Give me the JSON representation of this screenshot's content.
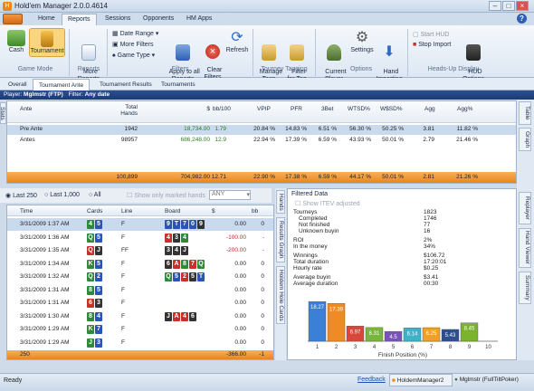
{
  "window": {
    "title": "Hold'em Manager 2.0.0.4614"
  },
  "menu_tabs": [
    "Home",
    "Reports",
    "Sessions",
    "Opponents",
    "HM Apps"
  ],
  "ribbon": {
    "cash": "Cash",
    "tournament": "Tournament",
    "game_mode": "Game Mode",
    "more_reports": "More\nReports",
    "reports": "Reports",
    "date_range": "Date Range",
    "more_filters": "More Filters",
    "game_type": "Game Type",
    "apply_all": "Apply to all\nReports",
    "clear_filters": "Clear\nFilters",
    "refresh": "Refresh",
    "filters": "Filters",
    "manage_tags": "Manage\nTags",
    "filter_for_tag": "Filter\nfor Tag",
    "tourney_tagging": "Tourney Tagging",
    "current_player": "Current\nPlayer",
    "settings": "Settings",
    "hand_importing": "Hand\nImporting",
    "options": "Options",
    "start_hud": "Start HUD",
    "stop_import": "Stop Import",
    "hud_options": "HUD\nOptions",
    "heads_up_display": "Heads-Up Display"
  },
  "sub_tabs": [
    "Overall",
    "Tournament Ante",
    "Tournament Results",
    "Tournaments"
  ],
  "player_bar": {
    "player_label": "Player:",
    "player": "Mglmstr (FTP)",
    "filter_label": "Filter:",
    "filter": "Any date"
  },
  "stats_table": {
    "headers": [
      "Ante",
      "Total\nHands",
      "$",
      "bb/100",
      "VPIP",
      "PFR",
      "3Bet",
      "WTSD%",
      "W$SD%",
      "Agg",
      "Agg%"
    ],
    "rows": [
      [
        "Pre Ante",
        "1942",
        "18,734.00",
        "1.79",
        "20.84 %",
        "14.83 %",
        "6.51 %",
        "56.30 %",
        "50.25 %",
        "3.81",
        "11.82 %"
      ],
      [
        "Antes",
        "98957",
        "686,248.00",
        "12.9",
        "22.94 %",
        "17.39 %",
        "6.59 %",
        "43.93 %",
        "50.01 %",
        "2.79",
        "21.46 %"
      ]
    ],
    "totals": [
      "",
      "100,899",
      "704,982.00",
      "12.71",
      "22.90 %",
      "17.38 %",
      "6.59 %",
      "44.17 %",
      "50.01 %",
      "2.81",
      "21.26 %"
    ],
    "stats_vtab": "Stats"
  },
  "right_vtabs_top": [
    "Table",
    "Graph"
  ],
  "hands_filter": {
    "last250": "Last 250",
    "last1000": "Last 1,000",
    "all": "All",
    "marked": "Show only marked hands",
    "any": "ANY"
  },
  "hands_table": {
    "headers": [
      "Time",
      "Cards",
      "Line",
      "Board",
      "$",
      "bb"
    ],
    "rows": [
      {
        "time": "3/31/2009 1:37 AM",
        "cards": [
          [
            "4",
            "g"
          ],
          [
            "5",
            "b"
          ]
        ],
        "line": "F",
        "board": [
          [
            "9",
            "b"
          ],
          [
            "T",
            "b"
          ],
          [
            "7",
            "b"
          ],
          [
            "0",
            "b"
          ],
          [
            "9",
            "k"
          ]
        ],
        "money": "0.00",
        "bb": "0"
      },
      {
        "time": "3/31/2009 1:36 AM",
        "cards": [
          [
            "Q",
            "g"
          ],
          [
            "5",
            "b"
          ]
        ],
        "line": "F",
        "board": [
          [
            "4",
            "r"
          ],
          [
            "3",
            "k"
          ],
          [
            "4",
            "g"
          ]
        ],
        "money": "-100.00",
        "bb": "-"
      },
      {
        "time": "3/31/2009 1:35 AM",
        "cards": [
          [
            "Q",
            "r"
          ],
          [
            "J",
            "k"
          ]
        ],
        "line": "FF",
        "board": [
          [
            "3",
            "k"
          ],
          [
            "4",
            "k"
          ],
          [
            "J",
            "k"
          ]
        ],
        "money": "-200.00",
        "bb": "-"
      },
      {
        "time": "3/31/2009 1:34 AM",
        "cards": [
          [
            "K",
            "g"
          ],
          [
            "5",
            "b"
          ]
        ],
        "line": "F",
        "board": [
          [
            "6",
            "k"
          ],
          [
            "A",
            "r"
          ],
          [
            "8",
            "g"
          ],
          [
            "7",
            "r"
          ],
          [
            "Q",
            "g"
          ]
        ],
        "money": "0.00",
        "bb": "0"
      },
      {
        "time": "3/31/2009 1:32 AM",
        "cards": [
          [
            "Q",
            "g"
          ],
          [
            "2",
            "b"
          ]
        ],
        "line": "F",
        "board": [
          [
            "Q",
            "g"
          ],
          [
            "5",
            "b"
          ],
          [
            "2",
            "r"
          ],
          [
            "5",
            "k"
          ],
          [
            "T",
            "b"
          ]
        ],
        "money": "0.00",
        "bb": "0"
      },
      {
        "time": "3/31/2009 1:31 AM",
        "cards": [
          [
            "8",
            "g"
          ],
          [
            "5",
            "b"
          ]
        ],
        "line": "F",
        "board": [],
        "money": "0.00",
        "bb": "0"
      },
      {
        "time": "3/31/2009 1:31 AM",
        "cards": [
          [
            "6",
            "r"
          ],
          [
            "3",
            "k"
          ]
        ],
        "line": "F",
        "board": [],
        "money": "0.00",
        "bb": "0"
      },
      {
        "time": "3/31/2009 1:30 AM",
        "cards": [
          [
            "8",
            "g"
          ],
          [
            "4",
            "b"
          ]
        ],
        "line": "F",
        "board": [
          [
            "J",
            "k"
          ],
          [
            "A",
            "r"
          ],
          [
            "4",
            "r"
          ],
          [
            "6",
            "k"
          ]
        ],
        "money": "0.00",
        "bb": "0"
      },
      {
        "time": "3/31/2009 1:29 AM",
        "cards": [
          [
            "K",
            "g"
          ],
          [
            "7",
            "b"
          ]
        ],
        "line": "F",
        "board": [],
        "money": "0.00",
        "bb": "0"
      },
      {
        "time": "3/31/2009 1:29 AM",
        "cards": [
          [
            "J",
            "g"
          ],
          [
            "3",
            "b"
          ]
        ],
        "line": "F",
        "board": [],
        "money": "0.00",
        "bb": "0"
      }
    ],
    "total_count": "250",
    "total_money": "-366.00",
    "total_bb": "-1"
  },
  "mid_vtabs": [
    "Hands",
    "Results Graph",
    "Holdem Hole Cards"
  ],
  "filtered": {
    "title": "Filtered Data",
    "show_itev": "Show ITEV adjusted",
    "rows": [
      [
        "Tourneys",
        "1823"
      ],
      [
        "Completed",
        "1746"
      ],
      [
        "Not finished",
        "77"
      ],
      [
        "Unknown buyin",
        "16"
      ],
      [
        "ROI",
        "2%"
      ],
      [
        "In the money",
        "34%"
      ],
      [
        "Winnings",
        "$106.72"
      ],
      [
        "Total duration",
        "17:20:01"
      ],
      [
        "Hourly rate",
        "$0.25"
      ],
      [
        "Average buyin",
        "$3.41"
      ],
      [
        "Average duration",
        "00:30"
      ]
    ]
  },
  "chart_data": {
    "type": "bar",
    "categories": [
      "1",
      "2",
      "3",
      "4",
      "5",
      "6",
      "7",
      "8",
      "9",
      "10"
    ],
    "values": [
      18.27,
      17.39,
      6.97,
      6.31,
      4.5,
      6.14,
      6.25,
      5.43,
      8.45,
      0
    ],
    "value_labels": [
      "18.27",
      "17.39",
      "6.97",
      "6.31",
      "4.5",
      "6.14",
      "6.25",
      "5.43",
      "8.45",
      ""
    ],
    "colors": [
      "#3b7fd6",
      "#f08a24",
      "#d9473a",
      "#78b640",
      "#7a53b8",
      "#3fb2c8",
      "#f0a028",
      "#2c4f8e",
      "#7bb22e",
      "#888888"
    ],
    "xlabel": "Finish Position (%)",
    "ylim": [
      0,
      22
    ]
  },
  "right_vtabs_bottom": [
    "Replayer",
    "Hand Viewer",
    "Summary"
  ],
  "status": {
    "ready": "Ready",
    "feedback": "Feedback",
    "hm": "HoldemManager2",
    "player": "Mglmstr (FullTiltPoker)"
  }
}
